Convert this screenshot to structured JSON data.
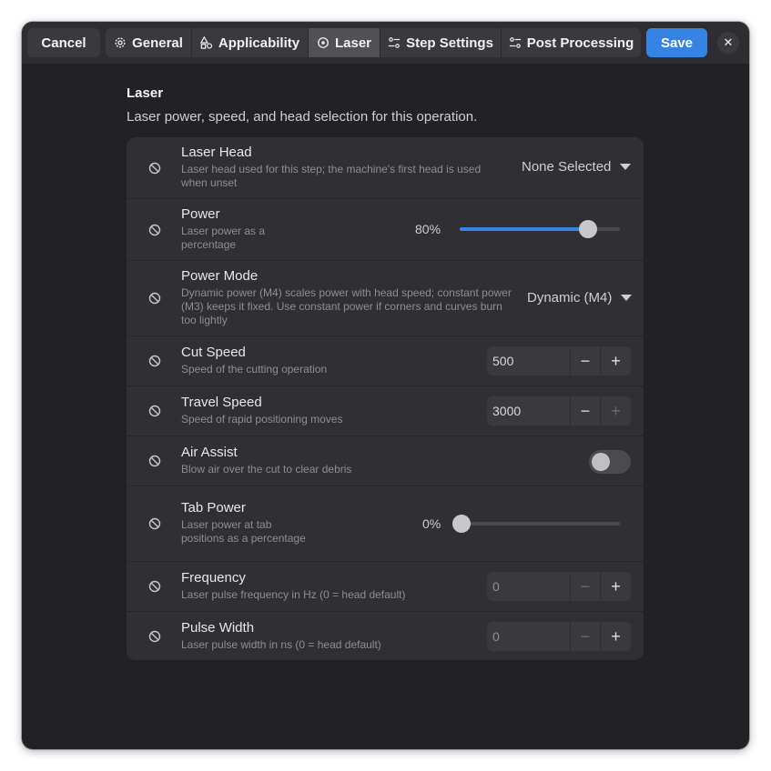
{
  "header": {
    "cancel_label": "Cancel",
    "save_label": "Save",
    "close_glyph": "✕",
    "tabs": [
      {
        "label": "General",
        "icon": "gear-icon"
      },
      {
        "label": "Applicability",
        "icon": "shapes-icon"
      },
      {
        "label": "Laser",
        "icon": "target-icon",
        "active": true
      },
      {
        "label": "Step Settings",
        "icon": "settings-sliders-icon"
      },
      {
        "label": "Post Processing",
        "icon": "settings-sliders-icon"
      }
    ]
  },
  "section": {
    "title": "Laser",
    "description": "Laser power, speed, and head selection for this operation."
  },
  "rows": {
    "laser_head": {
      "title": "Laser Head",
      "subtitle_1": "Laser head used for this step; the machine's first head is used",
      "subtitle_2": "when unset",
      "value": "None Selected"
    },
    "power": {
      "title": "Power",
      "subtitle_1": "Laser power as a",
      "subtitle_2": "percentage",
      "value_label": "80%",
      "value": 80
    },
    "power_mode": {
      "title": "Power Mode",
      "subtitle_1": "Dynamic power (M4) scales power with head speed; constant power",
      "subtitle_2": "(M3) keeps it fixed. Use constant power if corners and curves burn",
      "subtitle_3": "too lightly",
      "value": "Dynamic (M4)"
    },
    "cut_speed": {
      "title": "Cut Speed",
      "subtitle": "Speed of the cutting operation",
      "value": "500"
    },
    "travel_speed": {
      "title": "Travel Speed",
      "subtitle": "Speed of rapid positioning moves",
      "value": "3000"
    },
    "air_assist": {
      "title": "Air Assist",
      "subtitle": "Blow air over the cut to clear debris",
      "enabled": false
    },
    "tab_power": {
      "title": "Tab Power",
      "subtitle_1": "Laser power at tab",
      "subtitle_2": "positions as a percentage",
      "value_label": "0%",
      "value": 0
    },
    "frequency": {
      "title": "Frequency",
      "subtitle": "Laser pulse frequency in Hz (0 = head default)",
      "value": "0"
    },
    "pulse_width": {
      "title": "Pulse Width",
      "subtitle": "Laser pulse width in ns (0 = head default)",
      "value": "0"
    }
  },
  "spin_glyphs": {
    "minus": "−",
    "plus": "+"
  },
  "colors": {
    "accent": "#3584e4",
    "background": "#222226",
    "card": "#303034"
  }
}
